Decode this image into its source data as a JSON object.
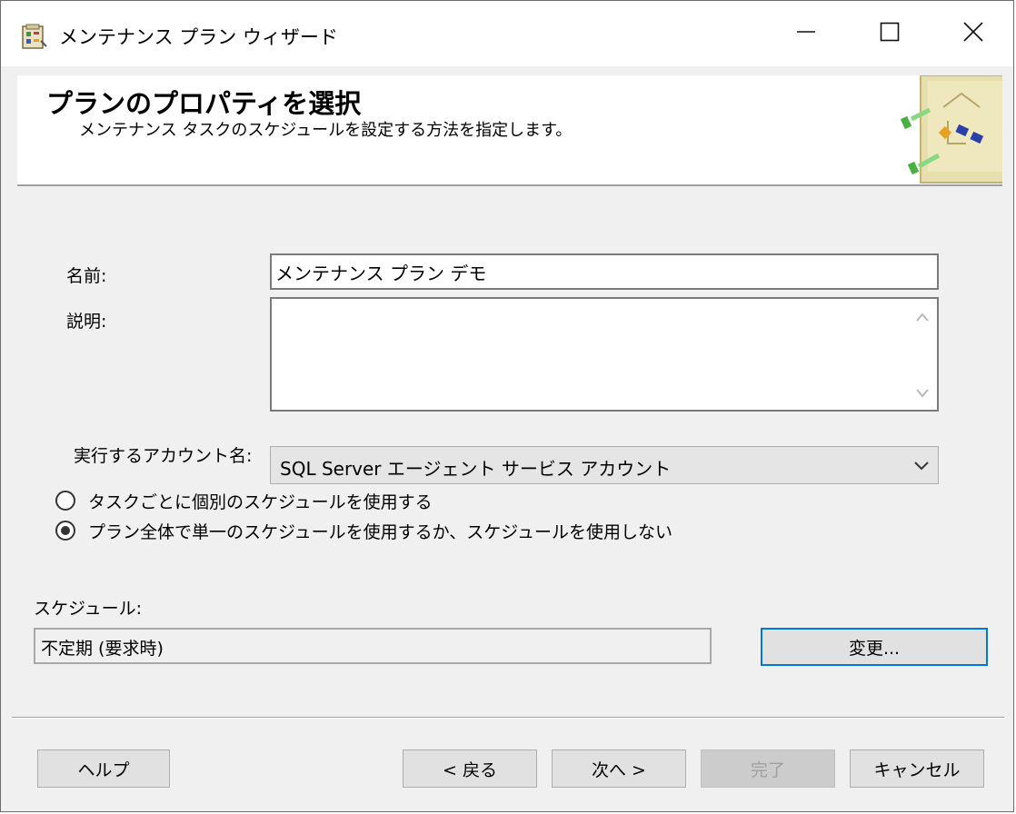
{
  "window": {
    "title": "メンテナンス プラン ウィザード",
    "icon": "wizard-app-icon",
    "controls": [
      "minimize-icon",
      "maximize-icon",
      "close-icon"
    ]
  },
  "header": {
    "title": "プランのプロパティを選択",
    "subtitle": "メンテナンス タスクのスケジュールを設定する方法を指定します。"
  },
  "form": {
    "name_label": "名前:",
    "name_value": "メンテナンス プラン デモ",
    "description_label": "説明:",
    "description_value": "",
    "account_label": "実行するアカウント名:",
    "account_value": "SQL Server エージェント サービス アカウント",
    "radio_separate": "タスクごとに個別のスケジュールを使用する",
    "radio_single": "プラン全体で単一のスケジュールを使用するか、スケジュールを使用しない",
    "selected_radio": "single"
  },
  "schedule": {
    "label": "スケジュール:",
    "value": "不定期 (要求時)",
    "change_button": "変更..."
  },
  "footer": {
    "help": "ヘルプ",
    "back": "< 戻る",
    "next": "次へ >",
    "finish": "完了",
    "cancel": "キャンセル"
  },
  "colors": {
    "focus_border": "#0078d7",
    "window_bg": "#f0f0f0",
    "disabled_text": "#a0a0a0"
  }
}
